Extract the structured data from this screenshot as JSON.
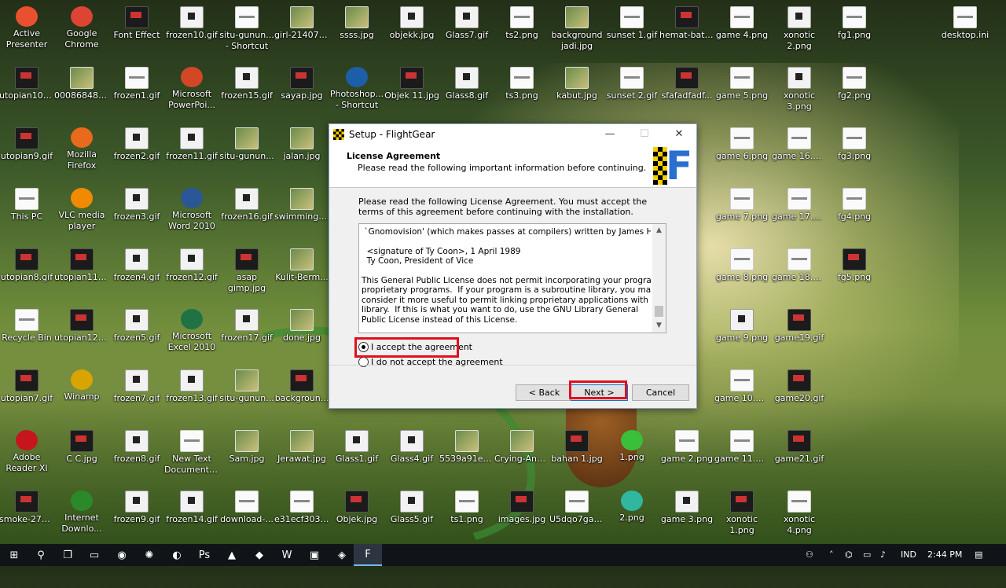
{
  "desktop": {
    "icons": [
      {
        "label": "Active\nPresenter",
        "kind": "round",
        "color": "#e85030"
      },
      {
        "label": "Google\nChrome",
        "kind": "round",
        "color": "#dd4433"
      },
      {
        "label": "Font Effect",
        "kind": "dark",
        "color": ""
      },
      {
        "label": "frozen10.gif",
        "kind": "thumb",
        "color": ""
      },
      {
        "label": "situ-gunun...\n- Shortcut",
        "kind": "white",
        "color": ""
      },
      {
        "label": "girl-214072...",
        "kind": "photo",
        "color": ""
      },
      {
        "label": "ssss.jpg",
        "kind": "photo",
        "color": ""
      },
      {
        "label": "objekk.jpg",
        "kind": "thumb",
        "color": ""
      },
      {
        "label": "Glass7.gif",
        "kind": "thumb",
        "color": ""
      },
      {
        "label": "ts2.png",
        "kind": "white",
        "color": ""
      },
      {
        "label": "background\njadi.jpg",
        "kind": "photo",
        "color": ""
      },
      {
        "label": "sunset 1.gif",
        "kind": "white",
        "color": ""
      },
      {
        "label": "hemat-batr...",
        "kind": "dark",
        "color": ""
      },
      {
        "label": "game 4.png",
        "kind": "white",
        "color": ""
      },
      {
        "label": "xonotic\n2.png",
        "kind": "thumb",
        "color": ""
      },
      {
        "label": "fg1.png",
        "kind": "white",
        "color": ""
      },
      {
        "label": "desktop.ini",
        "kind": "white",
        "color": ""
      },
      {
        "label": "utopian10.gif",
        "kind": "dark",
        "color": ""
      },
      {
        "label": "00086848.jpg",
        "kind": "photo",
        "color": ""
      },
      {
        "label": "frozen1.gif",
        "kind": "white",
        "color": ""
      },
      {
        "label": "Microsoft\nPowerPoi...",
        "kind": "round",
        "color": "#d24726"
      },
      {
        "label": "frozen15.gif",
        "kind": "thumb",
        "color": ""
      },
      {
        "label": "sayap.jpg",
        "kind": "dark",
        "color": ""
      },
      {
        "label": "Photoshop...\n- Shortcut",
        "kind": "round",
        "color": "#1c5fa8"
      },
      {
        "label": "Objek 11.jpg",
        "kind": "dark",
        "color": ""
      },
      {
        "label": "Glass8.gif",
        "kind": "thumb",
        "color": ""
      },
      {
        "label": "ts3.png",
        "kind": "white",
        "color": ""
      },
      {
        "label": "kabut.jpg",
        "kind": "photo",
        "color": ""
      },
      {
        "label": "sunset 2.gif",
        "kind": "white",
        "color": ""
      },
      {
        "label": "sfafadfadf...",
        "kind": "dark",
        "color": ""
      },
      {
        "label": "game 5.png",
        "kind": "white",
        "color": ""
      },
      {
        "label": "xonotic\n3.png",
        "kind": "thumb",
        "color": ""
      },
      {
        "label": "fg2.png",
        "kind": "white",
        "color": ""
      },
      {
        "label": "utopian9.gif",
        "kind": "dark",
        "color": ""
      },
      {
        "label": "Mozilla\nFirefox",
        "kind": "round",
        "color": "#e76a1d"
      },
      {
        "label": "frozen2.gif",
        "kind": "thumb",
        "color": ""
      },
      {
        "label": "frozen11.gif",
        "kind": "thumb",
        "color": ""
      },
      {
        "label": "situ-gunun...",
        "kind": "photo",
        "color": ""
      },
      {
        "label": "jalan.jpg",
        "kind": "photo",
        "color": ""
      },
      {
        "label": "game 6.png",
        "kind": "white",
        "color": ""
      },
      {
        "label": "game 16.png",
        "kind": "white",
        "color": ""
      },
      {
        "label": "fg3.png",
        "kind": "white",
        "color": ""
      },
      {
        "label": "This PC",
        "kind": "white",
        "color": ""
      },
      {
        "label": "VLC media\nplayer",
        "kind": "round",
        "color": "#f08a00"
      },
      {
        "label": "frozen3.gif",
        "kind": "thumb",
        "color": ""
      },
      {
        "label": "Microsoft\nWord 2010",
        "kind": "round",
        "color": "#2b5797"
      },
      {
        "label": "frozen16.gif",
        "kind": "thumb",
        "color": ""
      },
      {
        "label": "swimming....",
        "kind": "photo",
        "color": ""
      },
      {
        "label": "game 7.png",
        "kind": "white",
        "color": ""
      },
      {
        "label": "game 17.png",
        "kind": "white",
        "color": ""
      },
      {
        "label": "fg4.png",
        "kind": "white",
        "color": ""
      },
      {
        "label": "utopian8.gif",
        "kind": "dark",
        "color": ""
      },
      {
        "label": "utopian11.gif",
        "kind": "dark",
        "color": ""
      },
      {
        "label": "frozen4.gif",
        "kind": "thumb",
        "color": ""
      },
      {
        "label": "frozen12.gif",
        "kind": "thumb",
        "color": ""
      },
      {
        "label": "asap\ngimp.jpg",
        "kind": "dark",
        "color": ""
      },
      {
        "label": "Kulit-Berm...",
        "kind": "photo",
        "color": ""
      },
      {
        "label": "game 8.png",
        "kind": "white",
        "color": ""
      },
      {
        "label": "game 18.png",
        "kind": "white",
        "color": ""
      },
      {
        "label": "fg5.png",
        "kind": "dark",
        "color": ""
      },
      {
        "label": "Recycle Bin",
        "kind": "white",
        "color": ""
      },
      {
        "label": "utopian12.gif",
        "kind": "dark",
        "color": ""
      },
      {
        "label": "frozen5.gif",
        "kind": "thumb",
        "color": ""
      },
      {
        "label": "Microsoft\nExcel 2010",
        "kind": "round",
        "color": "#1f7244"
      },
      {
        "label": "frozen17.gif",
        "kind": "thumb",
        "color": ""
      },
      {
        "label": "done.jpg",
        "kind": "photo",
        "color": ""
      },
      {
        "label": "game 9.png",
        "kind": "thumb",
        "color": ""
      },
      {
        "label": "game19.gif",
        "kind": "dark",
        "color": ""
      },
      {
        "label": "utopian7.gif",
        "kind": "dark",
        "color": ""
      },
      {
        "label": "Winamp",
        "kind": "round",
        "color": "#d8a400"
      },
      {
        "label": "frozen7.gif",
        "kind": "thumb",
        "color": ""
      },
      {
        "label": "frozen13.gif",
        "kind": "thumb",
        "color": ""
      },
      {
        "label": "situ-gunun...",
        "kind": "photo",
        "color": ""
      },
      {
        "label": "backgroun...",
        "kind": "dark",
        "color": ""
      },
      {
        "label": "game 10.png",
        "kind": "white",
        "color": ""
      },
      {
        "label": "game20.gif",
        "kind": "dark",
        "color": ""
      },
      {
        "label": "Adobe\nReader XI",
        "kind": "round",
        "color": "#c4161c"
      },
      {
        "label": "C C.jpg",
        "kind": "dark",
        "color": ""
      },
      {
        "label": "frozen8.gif",
        "kind": "thumb",
        "color": ""
      },
      {
        "label": "New Text\nDocument....",
        "kind": "white",
        "color": ""
      },
      {
        "label": "Sam.jpg",
        "kind": "photo",
        "color": ""
      },
      {
        "label": "Jerawat.jpg",
        "kind": "photo",
        "color": ""
      },
      {
        "label": "Glass1.gif",
        "kind": "thumb",
        "color": ""
      },
      {
        "label": "Glass4.gif",
        "kind": "thumb",
        "color": ""
      },
      {
        "label": "5539a91e17...",
        "kind": "photo",
        "color": ""
      },
      {
        "label": "Crying-Ang...",
        "kind": "photo",
        "color": ""
      },
      {
        "label": "bahan 1.jpg",
        "kind": "dark",
        "color": ""
      },
      {
        "label": "1.png",
        "kind": "round",
        "color": "#3bbf3b"
      },
      {
        "label": "game 2.png",
        "kind": "white",
        "color": ""
      },
      {
        "label": "game 11.png",
        "kind": "white",
        "color": ""
      },
      {
        "label": "game21.gif",
        "kind": "dark",
        "color": ""
      },
      {
        "label": "smoke-272...",
        "kind": "dark",
        "color": ""
      },
      {
        "label": "Internet\nDownlo...",
        "kind": "round",
        "color": "#2a8a2a"
      },
      {
        "label": "frozen9.gif",
        "kind": "thumb",
        "color": ""
      },
      {
        "label": "frozen14.gif",
        "kind": "thumb",
        "color": ""
      },
      {
        "label": "download-...",
        "kind": "white",
        "color": ""
      },
      {
        "label": "e31ecf3030...",
        "kind": "white",
        "color": ""
      },
      {
        "label": "Objek.jpg",
        "kind": "dark",
        "color": ""
      },
      {
        "label": "Glass5.gif",
        "kind": "thumb",
        "color": ""
      },
      {
        "label": "ts1.png",
        "kind": "white",
        "color": ""
      },
      {
        "label": "images.jpg",
        "kind": "dark",
        "color": ""
      },
      {
        "label": "U5dqo7gaa...",
        "kind": "white",
        "color": ""
      },
      {
        "label": "2.png",
        "kind": "round",
        "color": "#2fb7a0"
      },
      {
        "label": "game 3.png",
        "kind": "thumb",
        "color": ""
      },
      {
        "label": "xonotic\n1.png",
        "kind": "dark",
        "color": ""
      },
      {
        "label": "xonotic\n4.png",
        "kind": "white",
        "color": ""
      }
    ]
  },
  "dialog": {
    "title": "Setup - FlightGear",
    "header_title": "License Agreement",
    "header_subtitle": "Please read the following important information before continuing.",
    "intro": "Please read the following License Agreement. You must accept the terms of this agreement before continuing with the installation.",
    "license_text": " `Gnomovision' (which makes passes at compilers) written by James Hacker.\n\n  <signature of Ty Coon>, 1 April 1989\n  Ty Coon, President of Vice\n\nThis General Public License does not permit incorporating your program into\nproprietary programs.  If your program is a subroutine library, you may\nconsider it more useful to permit linking proprietary applications with the\nlibrary.  If this is what you want to do, use the GNU Library General\nPublic License instead of this License.",
    "accept_label": "I accept the agreement",
    "decline_label": "I do not accept the agreement",
    "back_label": "< Back",
    "next_label": "Next >",
    "cancel_label": "Cancel",
    "minimize": "—",
    "maximize": "☐",
    "close": "✕",
    "accept_selected": true,
    "highlight_color": "#e0101e"
  },
  "taskbar": {
    "language": "IND",
    "time": "2:44 PM"
  }
}
